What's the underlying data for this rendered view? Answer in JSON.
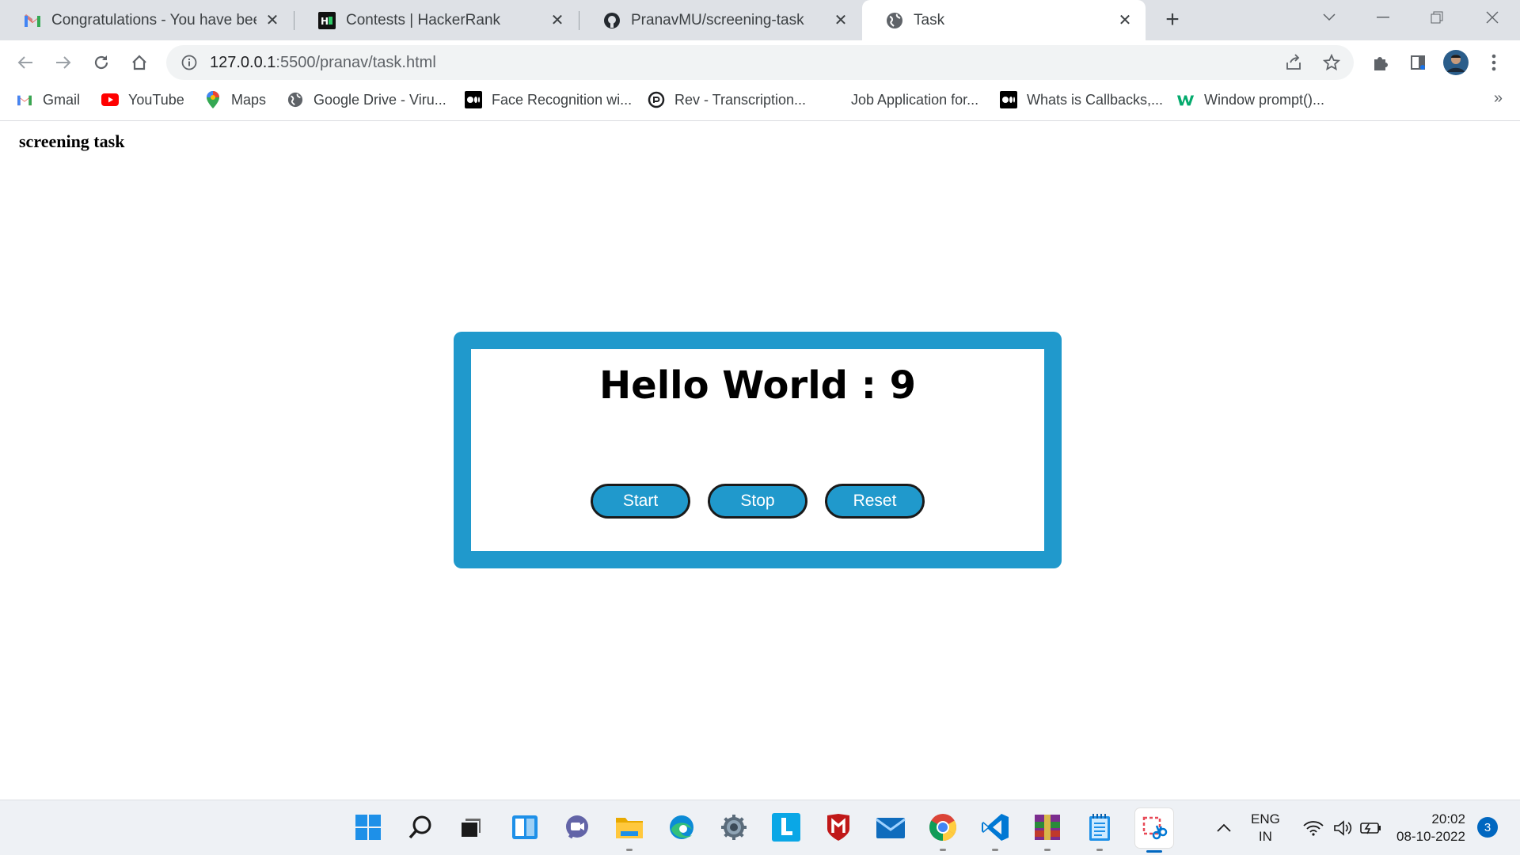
{
  "browser": {
    "tabs": [
      {
        "title": "Congratulations - You have been",
        "icon": "gmail-icon"
      },
      {
        "title": "Contests | HackerRank",
        "icon": "hackerrank-icon"
      },
      {
        "title": "PranavMU/screening-task",
        "icon": "github-icon"
      },
      {
        "title": "Task",
        "icon": "globe-icon",
        "active": true
      }
    ],
    "url_host": "127.0.0.1",
    "url_path": ":5500/pranav/task.html",
    "bookmarks": [
      {
        "label": "Gmail",
        "icon": "gmail-icon"
      },
      {
        "label": "YouTube",
        "icon": "youtube-icon"
      },
      {
        "label": "Maps",
        "icon": "maps-icon"
      },
      {
        "label": "Google Drive - Viru...",
        "icon": "globe-icon"
      },
      {
        "label": "Face Recognition wi...",
        "icon": "medium-icon"
      },
      {
        "label": "Rev - Transcription...",
        "icon": "rev-icon"
      },
      {
        "label": "Job Application for...",
        "icon": "blank-icon"
      },
      {
        "label": "Whats is Callbacks,...",
        "icon": "medium-icon"
      },
      {
        "label": "Window prompt()...",
        "icon": "w3schools-icon"
      }
    ],
    "bookmarks_overflow": "»"
  },
  "page": {
    "heading": "screening task",
    "counter_text": "Hello World : 9",
    "buttons": {
      "start": "Start",
      "stop": "Stop",
      "reset": "Reset"
    }
  },
  "colors": {
    "accent": "#2099cc",
    "tab_strip": "#dee1e6",
    "taskbar": "#eef1f5"
  },
  "taskbar": {
    "language_line1": "ENG",
    "language_line2": "IN",
    "time": "20:02",
    "date": "08-10-2022",
    "notification_count": "3"
  }
}
